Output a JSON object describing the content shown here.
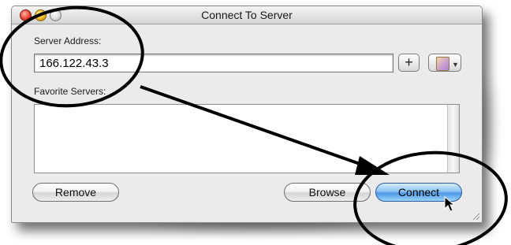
{
  "window": {
    "title": "Connect To Server"
  },
  "server_address": {
    "label": "Server Address:",
    "value": "166.122.43.3",
    "add_label": "+"
  },
  "favorites": {
    "label": "Favorite Servers:",
    "items": []
  },
  "buttons": {
    "remove_label": "Remove",
    "browse_label": "Browse",
    "connect_label": "Connect"
  },
  "annotation": {
    "ink_color": "#000000"
  },
  "icons": {
    "add": "plus-icon",
    "recent": "recent-servers-icon",
    "cursor": "mouse-pointer-icon"
  }
}
